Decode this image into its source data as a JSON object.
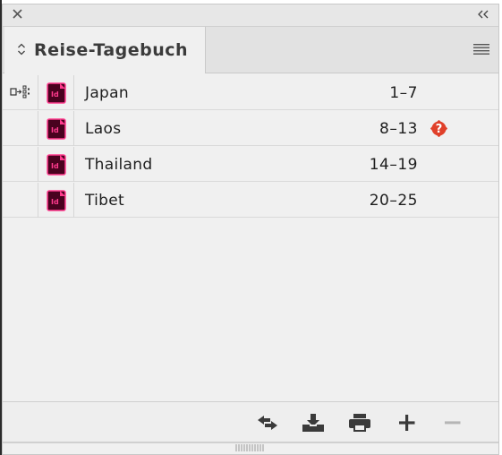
{
  "window": {
    "close_icon": "close-icon",
    "collapse_icon": "double-chevron-left-icon"
  },
  "tab": {
    "title": "Reise-Tagebuch",
    "sort_icon": "up-down-arrows-icon",
    "menu_icon": "hamburger-menu-icon"
  },
  "documents": [
    {
      "name": "Japan",
      "pages": "1–7",
      "icon": "indesign-document-icon",
      "style_source": true,
      "warning": false
    },
    {
      "name": "Laos",
      "pages": "8–13",
      "icon": "indesign-document-icon",
      "style_source": false,
      "warning": true
    },
    {
      "name": "Thailand",
      "pages": "14–19",
      "icon": "indesign-document-icon",
      "style_source": false,
      "warning": false
    },
    {
      "name": "Tibet",
      "pages": "20–25",
      "icon": "indesign-document-icon",
      "style_source": false,
      "warning": false
    }
  ],
  "toolbar": {
    "buttons": [
      "synchronize-icon",
      "save-icon",
      "print-icon",
      "add-icon",
      "remove-icon"
    ]
  },
  "colors": {
    "indesign_pink": "#ff3b8e",
    "indesign_dark": "#49021f",
    "warning_red": "#e0402a",
    "panel_bg": "#f0f0f0"
  }
}
